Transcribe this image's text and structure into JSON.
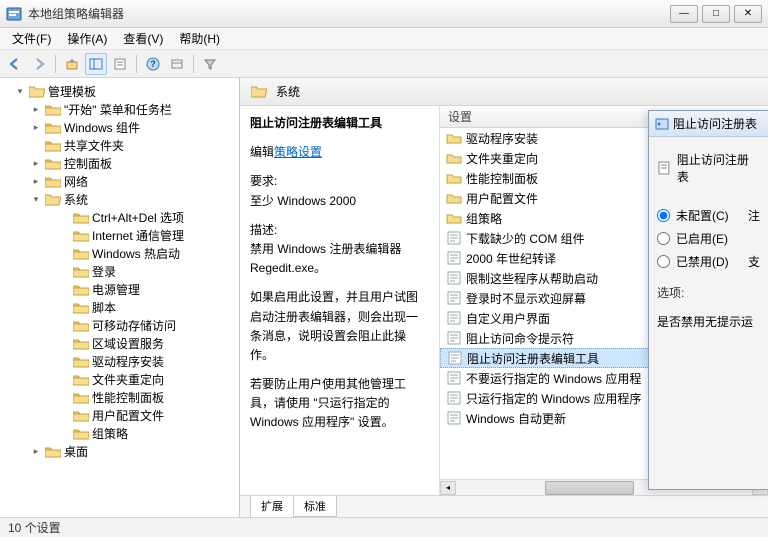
{
  "window": {
    "title": "本地组策略编辑器"
  },
  "win_buttons": {
    "min": "—",
    "max": "□",
    "close": "✕"
  },
  "menu": {
    "file": "文件(F)",
    "action": "操作(A)",
    "view": "查看(V)",
    "help": "帮助(H)"
  },
  "tree": {
    "root": "管理模板",
    "children": [
      {
        "label": "\"开始\" 菜单和任务栏",
        "expandable": true
      },
      {
        "label": "Windows 组件",
        "expandable": true
      },
      {
        "label": "共享文件夹",
        "expandable": false
      },
      {
        "label": "控制面板",
        "expandable": true
      },
      {
        "label": "网络",
        "expandable": true
      },
      {
        "label": "系统",
        "expandable": true,
        "expanded": true,
        "children": [
          "Ctrl+Alt+Del 选项",
          "Internet 通信管理",
          "Windows 热启动",
          "登录",
          "电源管理",
          "脚本",
          "可移动存储访问",
          "区域设置服务",
          "驱动程序安装",
          "文件夹重定向",
          "性能控制面板",
          "用户配置文件",
          "组策略"
        ]
      },
      {
        "label": "桌面",
        "expandable": true
      }
    ]
  },
  "header": {
    "title": "系统"
  },
  "desc": {
    "title": "阻止访问注册表编辑工具",
    "edit_label": "编辑",
    "edit_link": "策略设置",
    "req_label": "要求:",
    "req_value": "至少 Windows 2000",
    "desc_label": "描述:",
    "desc_p1": "禁用 Windows 注册表编辑器 Regedit.exe。",
    "desc_p2": "如果启用此设置，并且用户试图启动注册表编辑器，则会出现一条消息，说明设置会阻止此操作。",
    "desc_p3": "若要防止用户使用其他管理工具，请使用 \"只运行指定的 Windows 应用程序\" 设置。"
  },
  "list": {
    "header": "设置",
    "items": [
      {
        "icon": "folder",
        "label": "驱动程序安装"
      },
      {
        "icon": "folder",
        "label": "文件夹重定向"
      },
      {
        "icon": "folder",
        "label": "性能控制面板"
      },
      {
        "icon": "folder",
        "label": "用户配置文件"
      },
      {
        "icon": "folder",
        "label": "组策略"
      },
      {
        "icon": "policy",
        "label": "下载缺少的 COM 组件"
      },
      {
        "icon": "policy",
        "label": "2000 年世纪转译"
      },
      {
        "icon": "policy",
        "label": "限制这些程序从帮助启动"
      },
      {
        "icon": "policy",
        "label": "登录时不显示欢迎屏幕"
      },
      {
        "icon": "policy",
        "label": "自定义用户界面"
      },
      {
        "icon": "policy",
        "label": "阻止访问命令提示符"
      },
      {
        "icon": "policy",
        "label": "阻止访问注册表编辑工具",
        "selected": true
      },
      {
        "icon": "policy",
        "label": "不要运行指定的 Windows 应用程"
      },
      {
        "icon": "policy",
        "label": "只运行指定的 Windows 应用程序"
      },
      {
        "icon": "policy",
        "label": "Windows 自动更新"
      }
    ]
  },
  "tabs": {
    "extended": "扩展",
    "standard": "标准"
  },
  "status": {
    "text": "10 个设置"
  },
  "dialog": {
    "title": "阻止访问注册表",
    "subtitle": "阻止访问注册表",
    "radio_notconfig": "未配置(C)",
    "radio_enabled": "已启用(E)",
    "radio_disabled": "已禁用(D)",
    "extra1": "注",
    "extra2": "支",
    "options_label": "选项:",
    "option_text": "是否禁用无提示运"
  }
}
